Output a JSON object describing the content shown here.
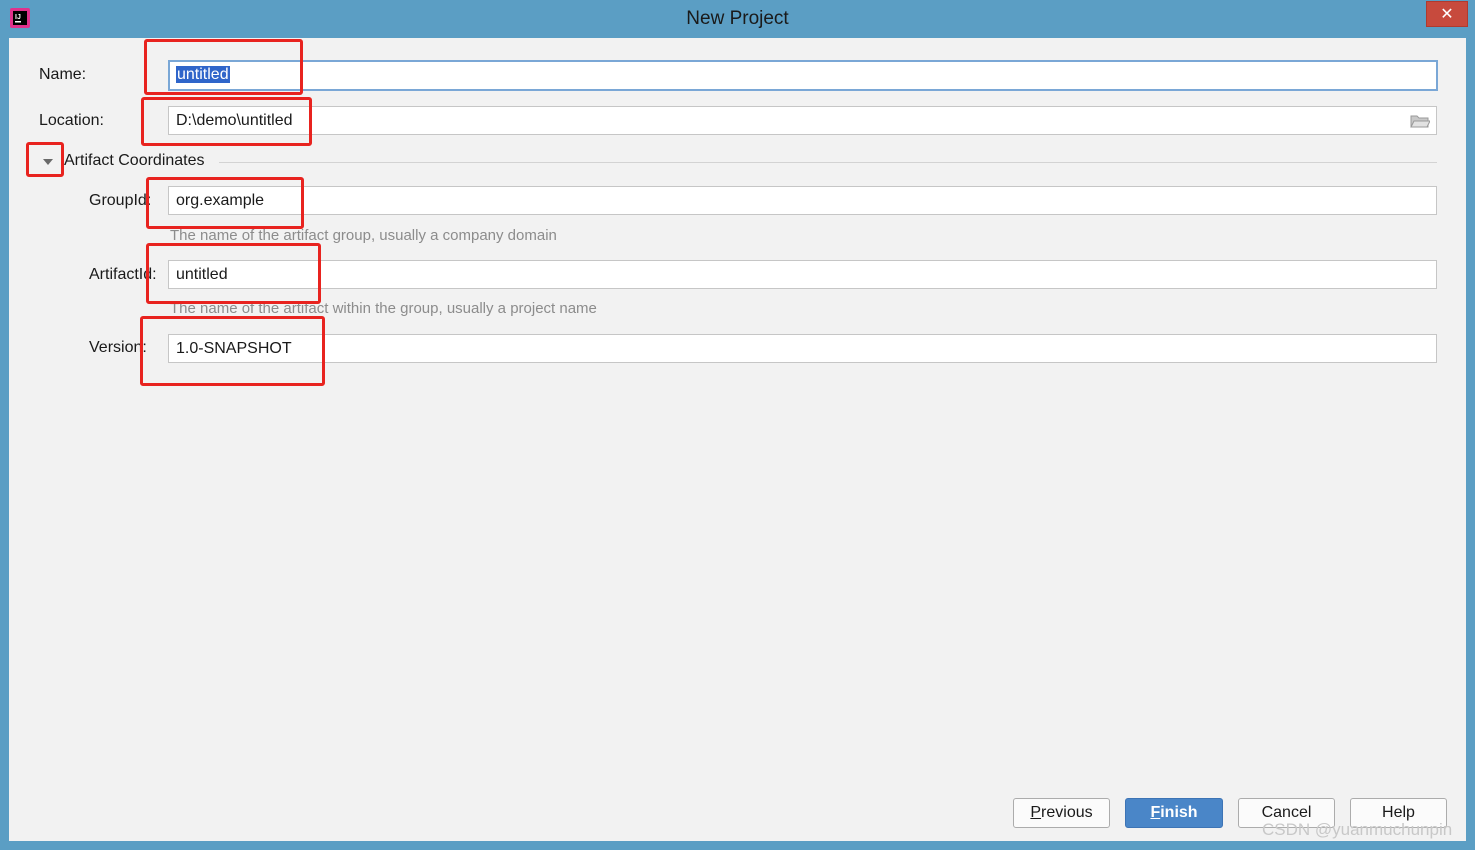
{
  "window": {
    "title": "New Project",
    "close_symbol": "✕",
    "app_icon": "intellij-idea-icon"
  },
  "form": {
    "name": {
      "label": "Name:",
      "value": "untitled"
    },
    "location": {
      "label": "Location:",
      "value": "D:\\demo\\untitled",
      "browse_icon": "folder-icon"
    },
    "artifact_section": {
      "label": "Artifact Coordinates",
      "expanded": true
    },
    "group_id": {
      "label": "GroupId:",
      "value": "org.example",
      "hint": "The name of the artifact group, usually a company domain"
    },
    "artifact_id": {
      "label": "ArtifactId:",
      "value": "untitled",
      "hint": "The name of the artifact within the group, usually a project name"
    },
    "version": {
      "label": "Version:",
      "value": "1.0-SNAPSHOT"
    }
  },
  "buttons": {
    "previous": {
      "mnemonic": "P",
      "rest": "revious"
    },
    "finish": {
      "mnemonic": "F",
      "rest": "inish"
    },
    "cancel": "Cancel",
    "help": "Help"
  },
  "watermark": "CSDN @yuanmuchunpin",
  "colors": {
    "titlebar": "#5b9ec4",
    "dialog_bg": "#f2f2f2",
    "primary_button": "#4a86c8",
    "selection": "#2f65ca",
    "annotation": "#e8231f"
  }
}
